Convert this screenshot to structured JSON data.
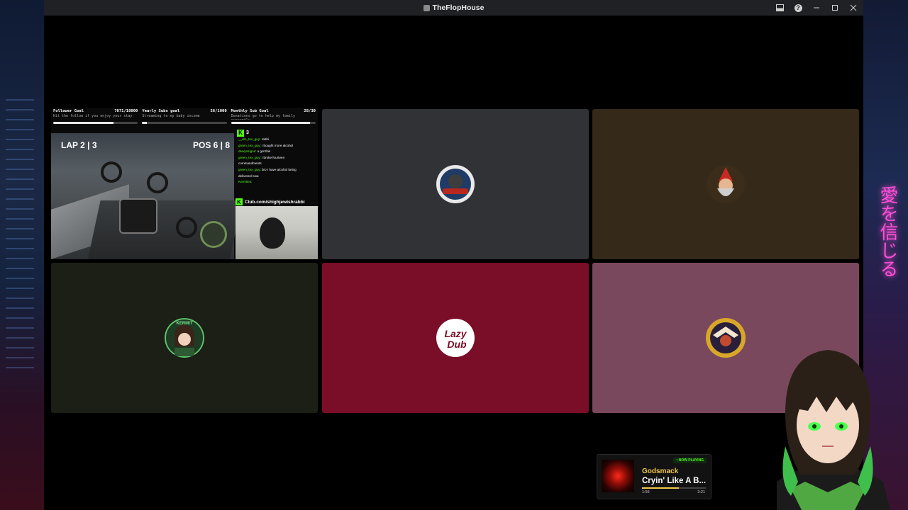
{
  "window": {
    "title": "TheFlopHouse"
  },
  "titlebar_buttons": [
    "inbox-icon",
    "help-icon",
    "minimize-icon",
    "maximize-icon",
    "close-icon"
  ],
  "tile_colors": [
    "#303236",
    "#35291a",
    "#1b1f15",
    "#7a0d27",
    "#7a485c"
  ],
  "stream": {
    "goals": [
      {
        "title": "Follower Goal",
        "value": "7071/10000",
        "sub": "Hit the follow if you enjoy your stay",
        "progress": 0.71
      },
      {
        "title": "Yearly Subs goal",
        "value": "56/1000",
        "sub": "Streaming to my baby income",
        "progress": 0.06
      },
      {
        "title": "Monthly Sub Goal",
        "value": "28/30",
        "sub": "Donations go to help my family currently",
        "progress": 0.93
      }
    ],
    "hud": {
      "lap": "LAP 2 | 3",
      "pos": "POS 6 | 8"
    },
    "chat": {
      "kick_count": "3",
      "messages": [
        {
          "user": "__dm_tex_guy",
          "text": ": rabbi"
        },
        {
          "user": "green_tex_guy",
          "text": ": I bought more alcohol"
        },
        {
          "user": "dewynsigns",
          "text": ": u got this"
        },
        {
          "user": "green_tex_guy",
          "text": ": I broke fourteen"
        },
        {
          "user": "",
          "text": "commandments"
        },
        {
          "user": "green_tex_guy",
          "text": ": bro I have alcohol being"
        },
        {
          "user": "",
          "text": "delivered now."
        },
        {
          "user": "Kermitex",
          "text": ":"
        }
      ],
      "cam_url": "Club.com/shighjewishrabbi"
    }
  },
  "participants": [
    {
      "name": "participant-vortex"
    },
    {
      "name": "participant-gnome"
    },
    {
      "name": "participant-kermitex",
      "label": "KERMIT"
    },
    {
      "name": "participant-lazydub",
      "label1": "Lazy",
      "label2": "Dub"
    },
    {
      "name": "participant-crest"
    }
  ],
  "now_playing": {
    "badge": "• NOW PLAYING",
    "artist": "Godsmack",
    "song": "Cryin' Like A B...",
    "elapsed": "1:56",
    "duration": "3:21",
    "progress": 0.58
  },
  "neon_text": "愛を信じる"
}
